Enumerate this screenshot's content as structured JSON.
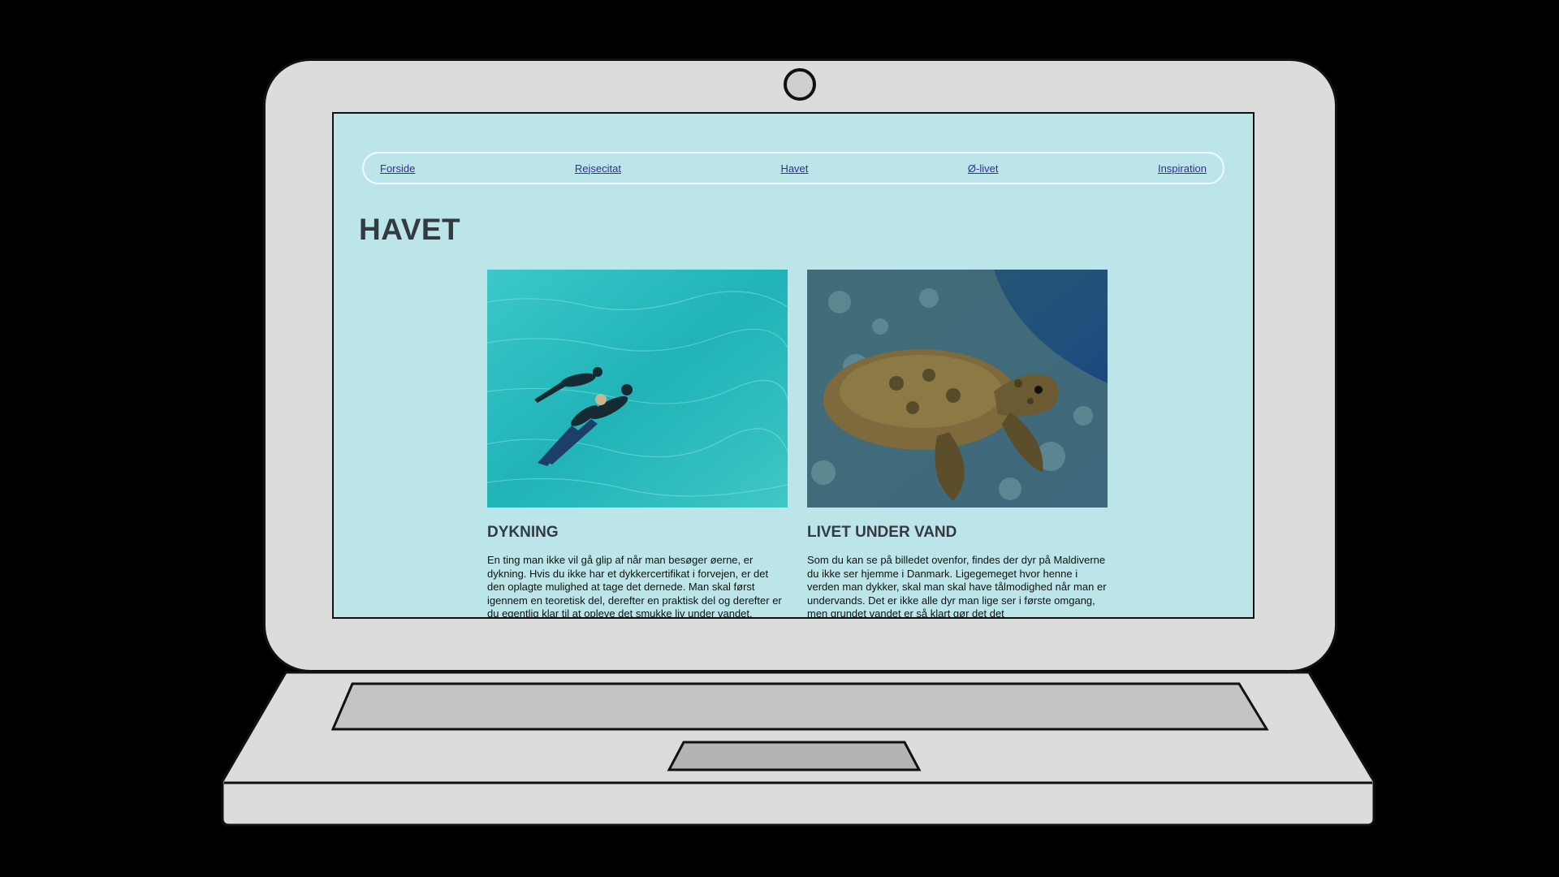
{
  "nav": {
    "items": [
      {
        "label": "Forside"
      },
      {
        "label": "Rejsecitat"
      },
      {
        "label": "Havet"
      },
      {
        "label": "Ø-livet"
      },
      {
        "label": "Inspiration"
      }
    ]
  },
  "page": {
    "title": "HAVET"
  },
  "cards": [
    {
      "heading": "DYKNING",
      "image": "snorkelers-in-turquoise-water",
      "text": "En ting man ikke vil gå glip af når man besøger øerne, er dykning. Hvis du ikke har et dykkercertifikat i forvejen, er det den oplagte mulighed at tage det dernede. Man skal først igennem en teoretisk del, derefter en praktisk del og derefter er du egentlig klar til at opleve det smukke liv under vandet."
    },
    {
      "heading": "LIVET UNDER VAND",
      "image": "sea-turtle-over-reef",
      "text": "Som du kan se på billedet ovenfor, findes der dyr på Maldiverne du ikke ser hjemme i Danmark. Ligegemeget hvor henne i verden man dykker, skal man skal have tålmodighed når man er undervands. Det er ikke alle dyr man lige ser i første omgang, men grundet vandet er så klart gør det det"
    }
  ],
  "colors": {
    "screen_bg": "#bce5e9",
    "laptop_body": "#dcdcdc",
    "link": "#3a2a9a",
    "heading": "#333a40"
  }
}
